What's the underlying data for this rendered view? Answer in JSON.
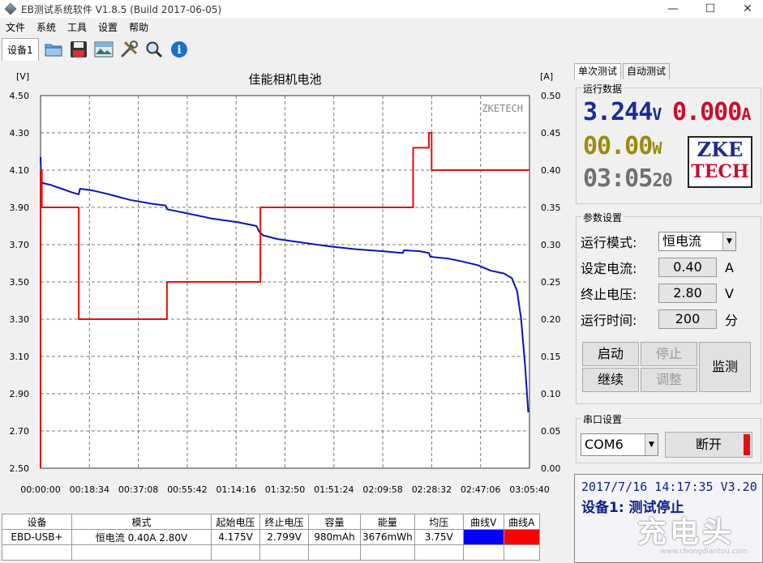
{
  "window": {
    "title": "EB测试系统软件 V1.8.5 (Build 2017-06-05)",
    "minimize": "—",
    "maximize": "☐",
    "close": "✕"
  },
  "menu": [
    "文件",
    "系统",
    "工具",
    "设置",
    "帮助"
  ],
  "toolbar": {
    "device_tab": "设备1",
    "icons": [
      "folder-icon",
      "save-icon",
      "picture-icon",
      "tools-icon",
      "search-icon",
      "info-icon"
    ]
  },
  "chart_data": {
    "type": "line",
    "title": "佳能相机电池",
    "watermark": "ZKETECH",
    "left_unit": "[V]",
    "right_unit": "[A]",
    "left_ticks": [
      "4.50",
      "4.30",
      "4.10",
      "3.90",
      "3.70",
      "3.50",
      "3.30",
      "3.10",
      "2.90",
      "2.70",
      "2.50"
    ],
    "right_ticks": [
      "0.50",
      "0.45",
      "0.40",
      "0.35",
      "0.30",
      "0.25",
      "0.20",
      "0.15",
      "0.10",
      "0.05",
      "0.00"
    ],
    "x_ticks": [
      "00:00:00",
      "00:18:34",
      "00:37:08",
      "00:55:42",
      "01:14:16",
      "01:32:50",
      "01:51:24",
      "02:09:58",
      "02:28:32",
      "02:47:06",
      "03:05:40"
    ],
    "ylim_left": [
      2.5,
      4.5
    ],
    "ylim_right": [
      0,
      0.5
    ],
    "xlim_min": [
      0,
      185.67
    ],
    "grid": true,
    "series": [
      {
        "name": "曲线V",
        "color": "#0a14b4",
        "axis": "left",
        "points": [
          [
            0,
            4.17
          ],
          [
            0.3,
            4.04
          ],
          [
            1,
            4.03
          ],
          [
            4,
            4.02
          ],
          [
            8,
            4.0
          ],
          [
            12,
            3.98
          ],
          [
            14.5,
            3.97
          ],
          [
            15,
            4.0
          ],
          [
            20,
            3.99
          ],
          [
            26,
            3.97
          ],
          [
            34,
            3.94
          ],
          [
            42,
            3.92
          ],
          [
            47.5,
            3.91
          ],
          [
            48,
            3.89
          ],
          [
            55,
            3.87
          ],
          [
            65,
            3.84
          ],
          [
            75,
            3.82
          ],
          [
            82,
            3.8
          ],
          [
            83,
            3.77
          ],
          [
            84.5,
            3.75
          ],
          [
            90,
            3.73
          ],
          [
            100,
            3.71
          ],
          [
            110,
            3.69
          ],
          [
            120,
            3.675
          ],
          [
            130,
            3.665
          ],
          [
            137.5,
            3.655
          ],
          [
            138,
            3.67
          ],
          [
            144,
            3.665
          ],
          [
            147.5,
            3.655
          ],
          [
            148,
            3.635
          ],
          [
            155,
            3.625
          ],
          [
            160,
            3.61
          ],
          [
            166,
            3.59
          ],
          [
            171,
            3.56
          ],
          [
            176,
            3.545
          ],
          [
            179,
            3.52
          ],
          [
            181,
            3.45
          ],
          [
            182.5,
            3.3
          ],
          [
            184,
            3.05
          ],
          [
            185.2,
            2.8
          ]
        ]
      },
      {
        "name": "曲线A",
        "color": "#e01010",
        "axis": "right",
        "points": [
          [
            0,
            0
          ],
          [
            0,
            0.4
          ],
          [
            0.5,
            0.4
          ],
          [
            0.5,
            0.35
          ],
          [
            14.5,
            0.35
          ],
          [
            14.5,
            0.2
          ],
          [
            48,
            0.2
          ],
          [
            48,
            0.25
          ],
          [
            83.5,
            0.25
          ],
          [
            83.5,
            0.35
          ],
          [
            141.5,
            0.35
          ],
          [
            141.5,
            0.43
          ],
          [
            147.5,
            0.43
          ],
          [
            147.5,
            0.45
          ],
          [
            148.5,
            0.45
          ],
          [
            148.5,
            0.4
          ],
          [
            185.67,
            0.4
          ]
        ]
      }
    ]
  },
  "right_panel": {
    "tabs": [
      "单次测试",
      "自动测试"
    ],
    "run_group_title": "运行数据",
    "voltage": "3.244",
    "voltage_unit": "V",
    "current": "0.000",
    "current_unit": "A",
    "power": "00.00",
    "power_unit": "W",
    "time_hm": "03:05",
    "time_s": "20",
    "logo_line1": "ZKE",
    "logo_line2": "TECH",
    "param_group_title": "参数设置",
    "mode_label": "运行模式:",
    "mode_value": "恒电流",
    "set_current_label": "设定电流:",
    "set_current_value": "0.40",
    "set_current_unit": "A",
    "end_voltage_label": "终止电压:",
    "end_voltage_value": "2.80",
    "end_voltage_unit": "V",
    "run_time_label": "运行时间:",
    "run_time_value": "200",
    "run_time_unit": "分",
    "btn_start": "启动",
    "btn_stop": "停止",
    "btn_continue": "继续",
    "btn_adjust": "调整",
    "btn_monitor": "监测",
    "serial_group_title": "串口设置",
    "com_port": "COM6",
    "btn_disconnect": "断开",
    "status_line1": "2017/7/16 14:17:35  V3.20",
    "status_line2": "设备1: 测试停止"
  },
  "table": {
    "headers": [
      "设备",
      "模式",
      "起始电压",
      "终止电压",
      "容量",
      "能量",
      "均压",
      "曲线V",
      "曲线A"
    ],
    "row": [
      "EBD-USB+",
      "恒电流  0.40A  2.80V",
      "4.175V",
      "2.799V",
      "980mAh",
      "3676mWh",
      "3.75V",
      "",
      ""
    ],
    "color_v": "#0000ff",
    "color_a": "#ff0000"
  },
  "watermark": {
    "text": "充电头",
    "url": "www.chongdiantou.com"
  }
}
